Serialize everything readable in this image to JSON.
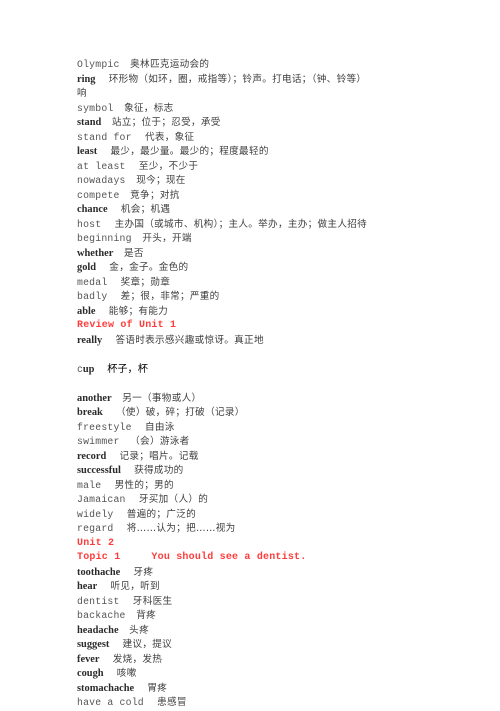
{
  "document": {
    "type": "vocabulary-list",
    "language_pair": "English-Chinese",
    "text_color": "#3a3a3a",
    "heading_color": "#ff3b3b",
    "background": "#ffffff"
  },
  "entries": [
    {
      "id": "olympic",
      "term": "Olympic",
      "bold": false,
      "gap": "    ",
      "definition": "奥林匹克运动会的"
    },
    {
      "id": "ring",
      "term": "ring",
      "bold": true,
      "gap": "     ",
      "definition": "环形物（如环，圈，戒指等）；铃声。打电话；（钟、铃等）",
      "wrap": "响"
    },
    {
      "id": "symbol",
      "term": "symbol",
      "bold": false,
      "gap": "    ",
      "definition": "象征，标志"
    },
    {
      "id": "stand",
      "term": "stand",
      "bold": true,
      "gap": "    ",
      "definition": "站立；位于；忍受，承受"
    },
    {
      "id": "stand-for",
      "term": "stand for",
      "bold": false,
      "gap": "     ",
      "definition": "代表，象征"
    },
    {
      "id": "least",
      "term": "least",
      "bold": true,
      "gap": "     ",
      "definition": "最少，最少量。最少的；程度最轻的"
    },
    {
      "id": "at-least",
      "term": "at least",
      "bold": false,
      "gap": "     ",
      "definition": "至少，不少于"
    },
    {
      "id": "nowadays",
      "term": "nowadays",
      "bold": false,
      "gap": "    ",
      "definition": "现今；现在"
    },
    {
      "id": "compete",
      "term": "compete",
      "bold": false,
      "gap": "    ",
      "definition": "竞争；对抗"
    },
    {
      "id": "chance",
      "term": "chance",
      "bold": true,
      "gap": "     ",
      "definition": "机会；机遇"
    },
    {
      "id": "host",
      "term": "host",
      "bold": false,
      "gap": "     ",
      "definition": "主办国（或城市、机构）；主人。举办，主办；做主人招待"
    },
    {
      "id": "beginning",
      "term": "beginning",
      "bold": false,
      "gap": "    ",
      "definition": "开头，开端"
    },
    {
      "id": "whether",
      "term": "whether",
      "bold": true,
      "gap": "    ",
      "definition": "是否"
    },
    {
      "id": "gold",
      "term": "gold",
      "bold": true,
      "gap": "     ",
      "definition": "金，金子。金色的"
    },
    {
      "id": "medal",
      "term": "medal",
      "bold": false,
      "gap": "     ",
      "definition": "奖章；勋章"
    },
    {
      "id": "badly",
      "term": "badly",
      "bold": false,
      "gap": "     ",
      "definition": "差；很，非常；严重的"
    },
    {
      "id": "able",
      "term": "able",
      "bold": true,
      "gap": "     ",
      "definition": "能够；有能力"
    },
    {
      "id": "review-of-unit-1",
      "kind": "heading",
      "text": "Review of Unit 1"
    },
    {
      "id": "really",
      "term": "really",
      "bold": true,
      "gap": "     ",
      "definition": "答语时表示感兴趣或惊讶。真正地"
    },
    {
      "id": "blank-1",
      "kind": "blank"
    },
    {
      "id": "cup",
      "kind": "cup",
      "term_first": "c",
      "term_rest": "up",
      "gap": "     ",
      "definition": "杯子，杯"
    },
    {
      "id": "blank-2",
      "kind": "blank"
    },
    {
      "id": "another",
      "term": "another",
      "bold": true,
      "gap": "    ",
      "definition": "另一（事物或人）"
    },
    {
      "id": "break",
      "term": "break",
      "bold": true,
      "gap": "     ",
      "definition": "（使）破，碎；打破（记录）"
    },
    {
      "id": "freestyle",
      "term": "freestyle",
      "bold": false,
      "gap": "     ",
      "definition": "自由泳"
    },
    {
      "id": "swimmer",
      "term": "swimmer",
      "bold": false,
      "gap": "    ",
      "definition": "（会）游泳者"
    },
    {
      "id": "record",
      "term": "record",
      "bold": true,
      "gap": "     ",
      "definition": "记录；唱片。记载"
    },
    {
      "id": "successful",
      "term": "successful",
      "bold": true,
      "gap": "     ",
      "definition": "获得成功的"
    },
    {
      "id": "male",
      "term": "male",
      "bold": false,
      "gap": "     ",
      "definition": "男性的；男的"
    },
    {
      "id": "jamaican",
      "term": "Jamaican",
      "bold": false,
      "gap": "     ",
      "definition": "牙买加（人）的"
    },
    {
      "id": "widely",
      "term": "widely",
      "bold": false,
      "gap": "     ",
      "definition": "普遍的；广泛的"
    },
    {
      "id": "regard",
      "term": "regard",
      "bold": false,
      "gap": "     ",
      "definition": "将……认为；把……视为"
    },
    {
      "id": "unit-2",
      "kind": "heading",
      "text": "Unit 2"
    },
    {
      "id": "topic-1",
      "kind": "heading",
      "text": "Topic 1     You should see a dentist."
    },
    {
      "id": "toothache",
      "term": "toothache",
      "bold": true,
      "gap": "     ",
      "definition": "牙疼"
    },
    {
      "id": "hear",
      "term": "hear",
      "bold": true,
      "gap": "     ",
      "definition": "听见，听到"
    },
    {
      "id": "dentist",
      "term": "dentist",
      "bold": false,
      "gap": "     ",
      "definition": "牙科医生"
    },
    {
      "id": "backache",
      "term": "backache",
      "bold": false,
      "gap": "    ",
      "definition": "背疼"
    },
    {
      "id": "headache",
      "term": "headache",
      "bold": true,
      "gap": "    ",
      "definition": "头疼"
    },
    {
      "id": "suggest",
      "term": "suggest",
      "bold": true,
      "gap": "     ",
      "definition": "建议，提议"
    },
    {
      "id": "fever",
      "term": "fever",
      "bold": true,
      "gap": "     ",
      "definition": "发烧，发热"
    },
    {
      "id": "cough",
      "term": "cough",
      "bold": true,
      "gap": "     ",
      "definition": "咳嗽"
    },
    {
      "id": "stomachache",
      "term": "stomachache",
      "bold": true,
      "gap": "     ",
      "definition": "胃疼"
    },
    {
      "id": "have-a-cold",
      "term": "have a cold",
      "bold": false,
      "gap": "     ",
      "definition": "患感冒"
    }
  ]
}
